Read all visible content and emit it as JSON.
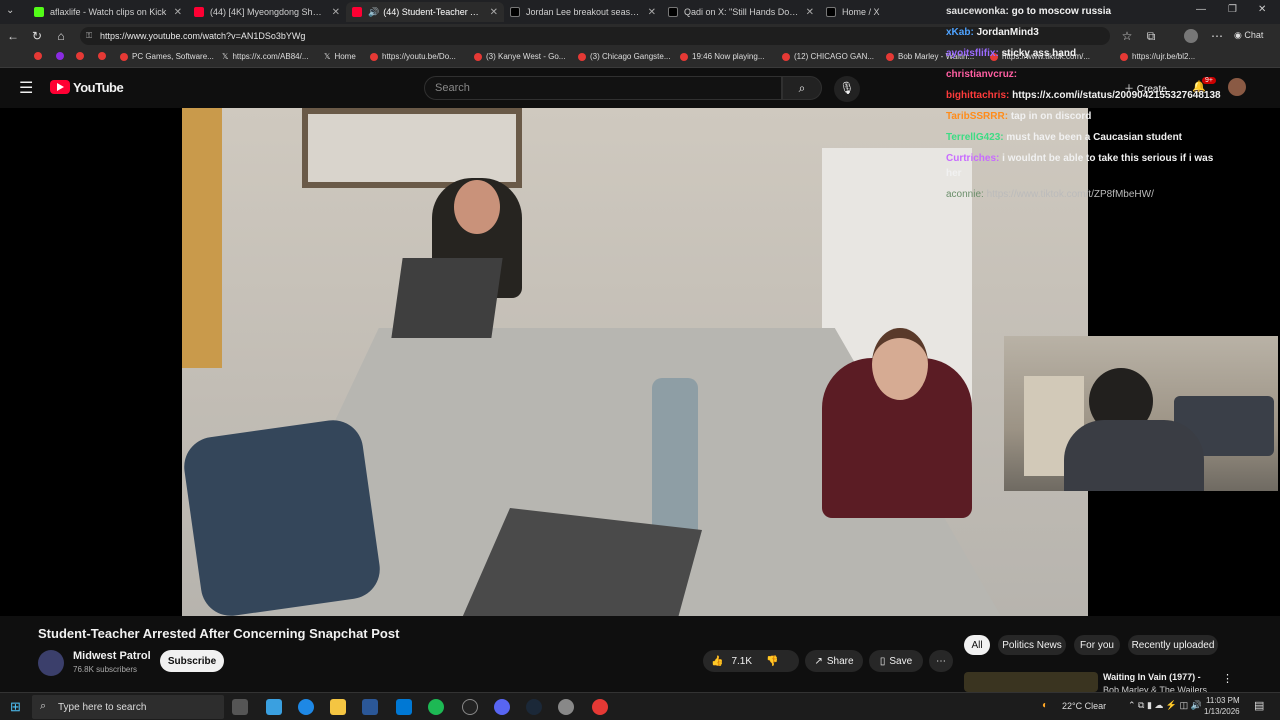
{
  "browser": {
    "tabs": [
      {
        "title": "aflaxlife - Watch clips on Kick",
        "color": "#53fc18"
      },
      {
        "title": "(44) [4K] Myeongdong Shopping",
        "color": "#ff0033"
      },
      {
        "title": "(44) Student-Teacher Arrest",
        "color": "#ff0033"
      },
      {
        "title": "Jordan Lee breakout season on X",
        "color": "#ffffff"
      },
      {
        "title": "Qadi on X: \"Still Hands Down The",
        "color": "#ffffff"
      },
      {
        "title": "Home / X",
        "color": "#ffffff"
      }
    ],
    "url": "https://www.youtube.com/watch?v=AN1DSo3bYWg",
    "bookmarks": [
      {
        "label": "PC Games, Software..."
      },
      {
        "label": "https://x.com/AB84/..."
      },
      {
        "label": "Home"
      },
      {
        "label": "https://youtu.be/Do..."
      },
      {
        "label": "(3) Kanye West - Go..."
      },
      {
        "label": "(3) Chicago Gangste..."
      },
      {
        "label": "19:46 Now playing..."
      },
      {
        "label": "(12) CHICAGO GAN..."
      },
      {
        "label": "Bob Marley - Waitin..."
      },
      {
        "label": "https://www.tiktok.com/..."
      },
      {
        "label": "https://ujr.be/bl2..."
      }
    ]
  },
  "youtube": {
    "logo_text": "YouTube",
    "search_placeholder": "Search",
    "create_label": "Create",
    "notif_count": "9+"
  },
  "chat": [
    {
      "user": "saucewonka:",
      "msg": "go to moscow russia",
      "color": "#e0e0e0"
    },
    {
      "user": "xKab:",
      "msg": "JordanMind3",
      "color": "#4fa3ff"
    },
    {
      "user": "ayoitsflifix:",
      "msg": "sticky ass hand",
      "color": "#9b6bff"
    },
    {
      "user": "christianvcruz:",
      "msg": "",
      "color": "#ff5fa2"
    },
    {
      "user": "bighittachris:",
      "msg": "https://x.com/i/status/2009042155327648138",
      "color": "#ff3b3b"
    },
    {
      "user": "TaribSSRRR:",
      "msg": "tap in on discord",
      "color": "#ff8c1a"
    },
    {
      "user": "TerrellG423:",
      "msg": "must have been a Caucasian student",
      "color": "#3ddc84"
    },
    {
      "user": "Curtriches:",
      "msg": "i wouldnt be able to take this serious if i was",
      "color": "#c86bff"
    },
    {
      "user": "",
      "msg": "her",
      "color": "#ffffff"
    },
    {
      "user": "aconnie:",
      "msg": "https://www.tiktok.com/t/ZP8fMbeHW/",
      "color": "#6b8f6b"
    }
  ],
  "video": {
    "title": "Student-Teacher Arrested After Concerning Snapchat Post",
    "channel": "Midwest Patrol",
    "subscribers": "76.8K subscribers",
    "subscribe_label": "Subscribe",
    "likes": "7.1K",
    "share_label": "Share",
    "save_label": "Save"
  },
  "filters": [
    "All",
    "Politics News",
    "For you",
    "Recently uploaded"
  ],
  "recommended": {
    "title": "Waiting In Vain (1977) -",
    "subtitle": "Bob Marley & The Wailers"
  },
  "taskbar": {
    "search_placeholder": "Type here to search",
    "weather": "22°C  Clear",
    "time": "11:03 PM",
    "date": "1/13/2026"
  },
  "colors": {
    "accent": "#ff0033",
    "background": "#0f0f0f"
  }
}
